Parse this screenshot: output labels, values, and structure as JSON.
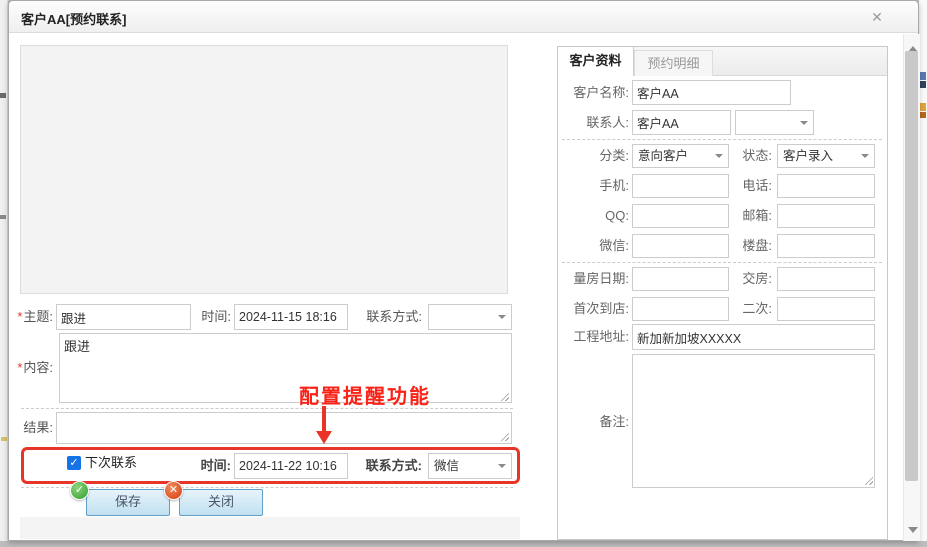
{
  "window": {
    "title": "客户AA[预约联系]"
  },
  "icons": {
    "close": "✕",
    "checkbox_check": "✓",
    "save_badge": "✓",
    "close_badge": "✕"
  },
  "left_form": {
    "required_mark": "*",
    "subject_label": "主题:",
    "subject_value": "跟进",
    "time_label": "时间:",
    "time_value": "2024-11-15 18:16",
    "contact_method_label": "联系方式:",
    "contact_method_value": "",
    "content_label": "内容:",
    "content_value": "跟进",
    "result_label": "结果:",
    "result_value": "",
    "next_contact_label": "下次联系",
    "next_time_label": "时间:",
    "next_time_value": "2024-11-22 10:16",
    "next_method_label": "联系方式:",
    "next_method_value": "微信",
    "save_button": "保存",
    "close_button": "关闭",
    "annotation": "配置提醒功能"
  },
  "right_panel": {
    "tabs": [
      {
        "label": "客户资料"
      },
      {
        "label": "预约明细"
      }
    ],
    "customer_name_label": "客户名称:",
    "customer_name_value": "客户AA",
    "contact_label": "联系人:",
    "contact_value": "客户AA",
    "contact_extra_value": "",
    "category_label": "分类:",
    "category_value": "意向客户",
    "status_label": "状态:",
    "status_value": "客户录入",
    "mobile_label": "手机:",
    "mobile_value": "",
    "phone_label": "电话:",
    "phone_value": "",
    "qq_label": "QQ:",
    "qq_value": "",
    "email_label": "邮箱:",
    "email_value": "",
    "wechat_label": "微信:",
    "wechat_value": "",
    "building_label": "楼盘:",
    "building_value": "",
    "measure_label": "量房日期:",
    "measure_value": "",
    "delivery_label": "交房:",
    "delivery_value": "",
    "first_label": "首次到店:",
    "first_value": "",
    "second_label": "二次:",
    "second_value": "",
    "address_label": "工程地址:",
    "address_value": "新加新加坡XXXXX",
    "remark_label": "备注:",
    "remark_value": ""
  },
  "colors": {
    "accent_red": "#e8352a",
    "checkbox_blue": "#1673e6",
    "button_border": "#62a0c8",
    "button_fill": "#cfe7f4"
  }
}
